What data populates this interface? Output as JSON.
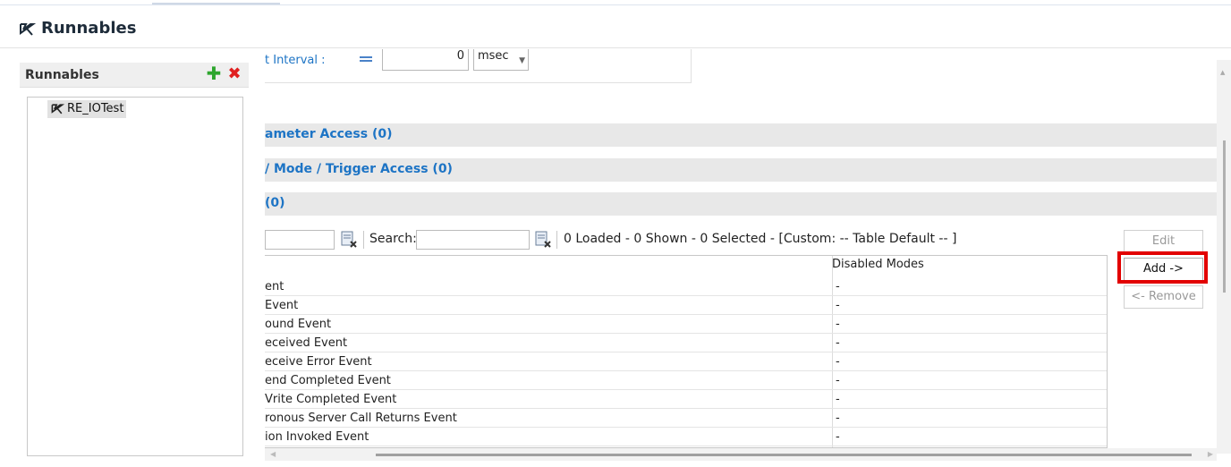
{
  "header": {
    "title": "Runnables"
  },
  "left_panel": {
    "title": "Runnables",
    "add_icon": "plus-icon",
    "delete_icon": "delete-icon",
    "items": [
      {
        "label": "RE_IOTest"
      }
    ]
  },
  "interval": {
    "label": "t Interval :",
    "value": "0",
    "unit": "msec"
  },
  "sections": [
    {
      "label": "ameter Access (0)"
    },
    {
      "label": "/ Mode / Trigger Access (0)"
    },
    {
      "label": "(0)"
    }
  ],
  "toolbar": {
    "search_label": "Search:",
    "status": "0 Loaded - 0 Shown - 0 Selected -  [Custom: -- Table Default -- ]"
  },
  "table": {
    "columns": [
      "",
      "Disabled Modes"
    ],
    "rows": [
      {
        "event": "ent",
        "modes": "-"
      },
      {
        "event": " Event",
        "modes": "-"
      },
      {
        "event": "ound Event",
        "modes": "-"
      },
      {
        "event": "eceived Event",
        "modes": "-"
      },
      {
        "event": "eceive Error Event",
        "modes": "-"
      },
      {
        "event": "end Completed Event",
        "modes": "-"
      },
      {
        "event": "Vrite Completed Event",
        "modes": "-"
      },
      {
        "event": "ronous Server Call Returns Event",
        "modes": "-"
      },
      {
        "event": "ion Invoked Event",
        "modes": "-"
      }
    ]
  },
  "buttons": {
    "edit": "Edit",
    "add": "Add ->",
    "remove": "<- Remove"
  },
  "colors": {
    "accent": "#1d74c5",
    "highlight": "#e20000",
    "add_icon": "#2ea62e",
    "delete_icon": "#e02020"
  }
}
